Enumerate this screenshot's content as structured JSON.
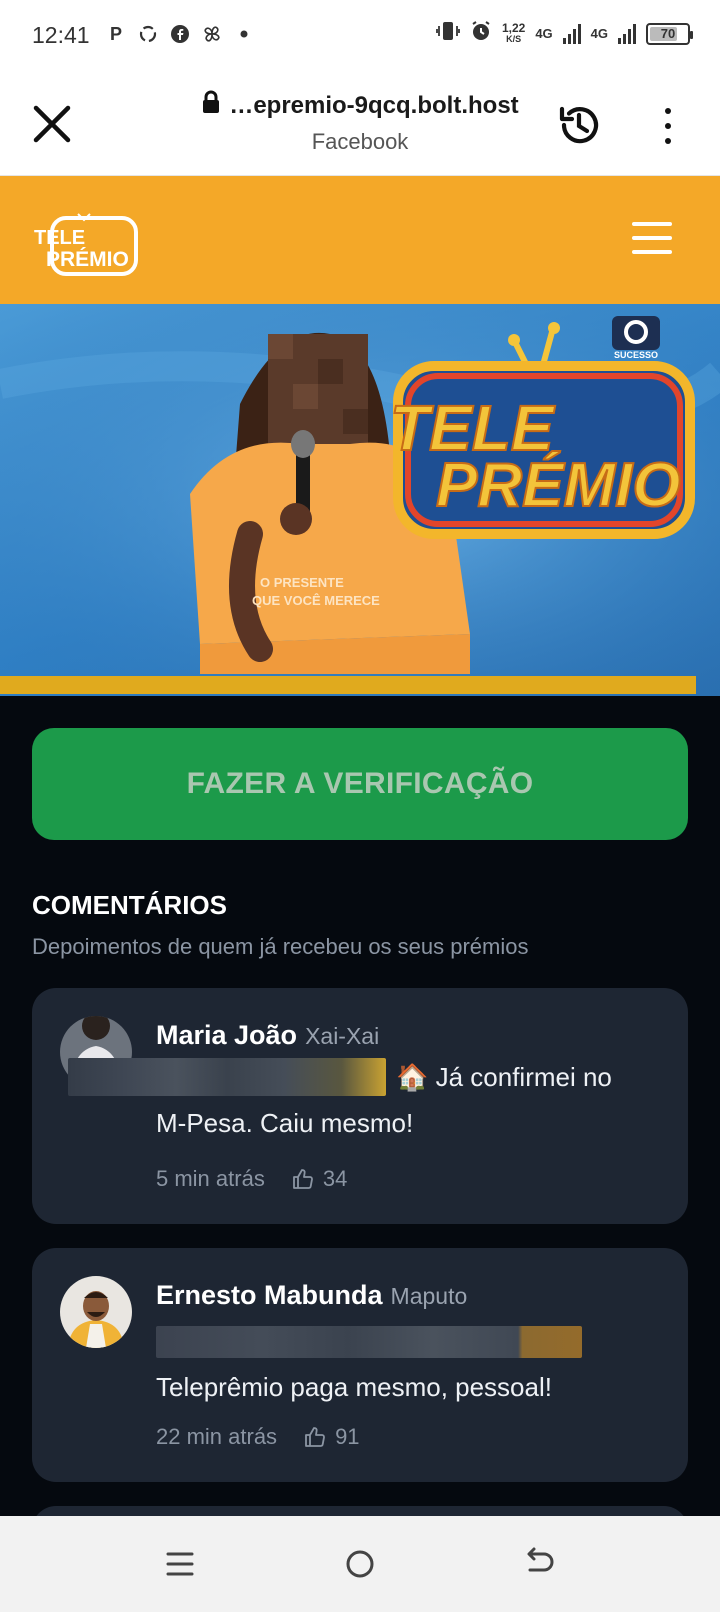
{
  "status_bar": {
    "time": "12:41",
    "app_icons": [
      "P",
      "sync-icon",
      "facebook-icon",
      "pinwheel-icon",
      "dot-icon"
    ],
    "speed_value": "1,22",
    "speed_unit": "K/S",
    "network_1": "4G",
    "network_2": "4G",
    "battery": "70"
  },
  "browser": {
    "url": "…epremio-9qcq.bolt.host",
    "source": "Facebook"
  },
  "site": {
    "logo_line1": "TELE",
    "logo_line2": "PRÉMIO",
    "brand_color": "#f4a828"
  },
  "hero": {
    "sign_line1": "TELE",
    "sign_line2": "PRÉMIO",
    "channel_badge": "SUCESSO",
    "shirt_line1": "O PRESENTE",
    "shirt_line2": "QUE VOCÊ MERECE"
  },
  "verify_button": {
    "label": "FAZER A VERIFICAÇÃO",
    "color": "#1c9a4a"
  },
  "comments": {
    "title": "COMENTÁRIOS",
    "subtitle": "Depoimentos de quem já recebeu os seus prémios",
    "items": [
      {
        "name": "Maria João",
        "location": "Xai-Xai",
        "text_line1": "🏠 Já confirmei no",
        "text_line2": "M-Pesa. Caiu mesmo!",
        "time": "5 min atrás",
        "likes": "34"
      },
      {
        "name": "Ernesto Mabunda",
        "location": "Maputo",
        "text": "Teleprêmio paga mesmo, pessoal!",
        "time": "22 min atrás",
        "likes": "91"
      }
    ]
  }
}
